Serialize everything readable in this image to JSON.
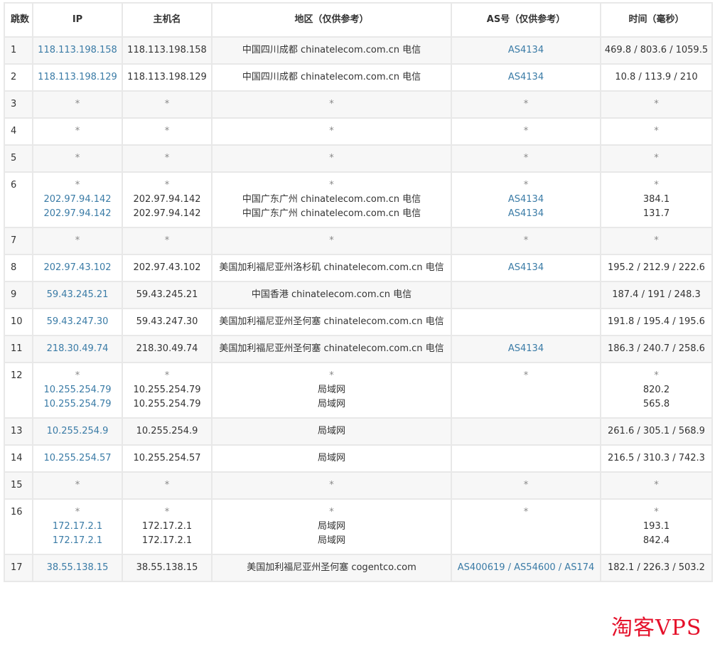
{
  "headers": {
    "hop": "跳数",
    "ip": "IP",
    "hostname": "主机名",
    "region": "地区（仅供参考）",
    "asn": "AS号（仅供参考）",
    "time": "时间（毫秒）"
  },
  "rows": [
    {
      "hop": "1",
      "ip": [
        "118.113.198.158"
      ],
      "host": [
        "118.113.198.158"
      ],
      "region": [
        "中国四川成都 chinatelecom.com.cn 电信"
      ],
      "asn": [
        "AS4134"
      ],
      "time": [
        "469.8 / 803.6 / 1059.5"
      ]
    },
    {
      "hop": "2",
      "ip": [
        "118.113.198.129"
      ],
      "host": [
        "118.113.198.129"
      ],
      "region": [
        "中国四川成都 chinatelecom.com.cn 电信"
      ],
      "asn": [
        "AS4134"
      ],
      "time": [
        "10.8 / 113.9 / 210"
      ]
    },
    {
      "hop": "3",
      "ip": [
        "*"
      ],
      "host": [
        "*"
      ],
      "region": [
        "*"
      ],
      "asn": [
        "*"
      ],
      "time": [
        "*"
      ]
    },
    {
      "hop": "4",
      "ip": [
        "*"
      ],
      "host": [
        "*"
      ],
      "region": [
        "*"
      ],
      "asn": [
        "*"
      ],
      "time": [
        "*"
      ]
    },
    {
      "hop": "5",
      "ip": [
        "*"
      ],
      "host": [
        "*"
      ],
      "region": [
        "*"
      ],
      "asn": [
        "*"
      ],
      "time": [
        "*"
      ]
    },
    {
      "hop": "6",
      "ip": [
        "*",
        "202.97.94.142",
        "202.97.94.142"
      ],
      "host": [
        "*",
        "202.97.94.142",
        "202.97.94.142"
      ],
      "region": [
        "*",
        "中国广东广州 chinatelecom.com.cn 电信",
        "中国广东广州 chinatelecom.com.cn 电信"
      ],
      "asn": [
        "*",
        "AS4134",
        "AS4134"
      ],
      "time": [
        "*",
        "384.1",
        "131.7"
      ]
    },
    {
      "hop": "7",
      "ip": [
        "*"
      ],
      "host": [
        "*"
      ],
      "region": [
        "*"
      ],
      "asn": [
        "*"
      ],
      "time": [
        "*"
      ]
    },
    {
      "hop": "8",
      "ip": [
        "202.97.43.102"
      ],
      "host": [
        "202.97.43.102"
      ],
      "region": [
        "美国加利福尼亚州洛杉矶 chinatelecom.com.cn 电信"
      ],
      "asn": [
        "AS4134"
      ],
      "time": [
        "195.2 / 212.9 / 222.6"
      ]
    },
    {
      "hop": "9",
      "ip": [
        "59.43.245.21"
      ],
      "host": [
        "59.43.245.21"
      ],
      "region": [
        "中国香港 chinatelecom.com.cn 电信"
      ],
      "asn": [
        ""
      ],
      "time": [
        "187.4 / 191 / 248.3"
      ]
    },
    {
      "hop": "10",
      "ip": [
        "59.43.247.30"
      ],
      "host": [
        "59.43.247.30"
      ],
      "region": [
        "美国加利福尼亚州圣何塞 chinatelecom.com.cn 电信"
      ],
      "asn": [
        ""
      ],
      "time": [
        "191.8 / 195.4 / 195.6"
      ]
    },
    {
      "hop": "11",
      "ip": [
        "218.30.49.74"
      ],
      "host": [
        "218.30.49.74"
      ],
      "region": [
        "美国加利福尼亚州圣何塞 chinatelecom.com.cn 电信"
      ],
      "asn": [
        "AS4134"
      ],
      "time": [
        "186.3 / 240.7 / 258.6"
      ]
    },
    {
      "hop": "12",
      "ip": [
        "*",
        "10.255.254.79",
        "10.255.254.79"
      ],
      "host": [
        "*",
        "10.255.254.79",
        "10.255.254.79"
      ],
      "region": [
        "*",
        "局域网",
        "局域网"
      ],
      "asn": [
        "*"
      ],
      "time": [
        "*",
        "820.2",
        "565.8"
      ]
    },
    {
      "hop": "13",
      "ip": [
        "10.255.254.9"
      ],
      "host": [
        "10.255.254.9"
      ],
      "region": [
        "局域网"
      ],
      "asn": [
        ""
      ],
      "time": [
        "261.6 / 305.1 / 568.9"
      ]
    },
    {
      "hop": "14",
      "ip": [
        "10.255.254.57"
      ],
      "host": [
        "10.255.254.57"
      ],
      "region": [
        "局域网"
      ],
      "asn": [
        ""
      ],
      "time": [
        "216.5 / 310.3 / 742.3"
      ]
    },
    {
      "hop": "15",
      "ip": [
        "*"
      ],
      "host": [
        "*"
      ],
      "region": [
        "*"
      ],
      "asn": [
        "*"
      ],
      "time": [
        "*"
      ]
    },
    {
      "hop": "16",
      "ip": [
        "*",
        "172.17.2.1",
        "172.17.2.1"
      ],
      "host": [
        "*",
        "172.17.2.1",
        "172.17.2.1"
      ],
      "region": [
        "*",
        "局域网",
        "局域网"
      ],
      "asn": [
        "*"
      ],
      "time": [
        "*",
        "193.1",
        "842.4"
      ]
    },
    {
      "hop": "17",
      "ip": [
        "38.55.138.15"
      ],
      "host": [
        "38.55.138.15"
      ],
      "region": [
        "美国加利福尼亚州圣何塞 cogentco.com"
      ],
      "asn": [
        "AS400619 / AS54600 / AS174"
      ],
      "time": [
        "182.1 / 226.3 / 503.2"
      ]
    }
  ],
  "watermark": "淘客VPS",
  "colors": {
    "link": "#3a7ba6",
    "text": "#333333",
    "alt_row": "#f7f7f7",
    "border": "#e8e8e8",
    "watermark": "#e5102a"
  }
}
